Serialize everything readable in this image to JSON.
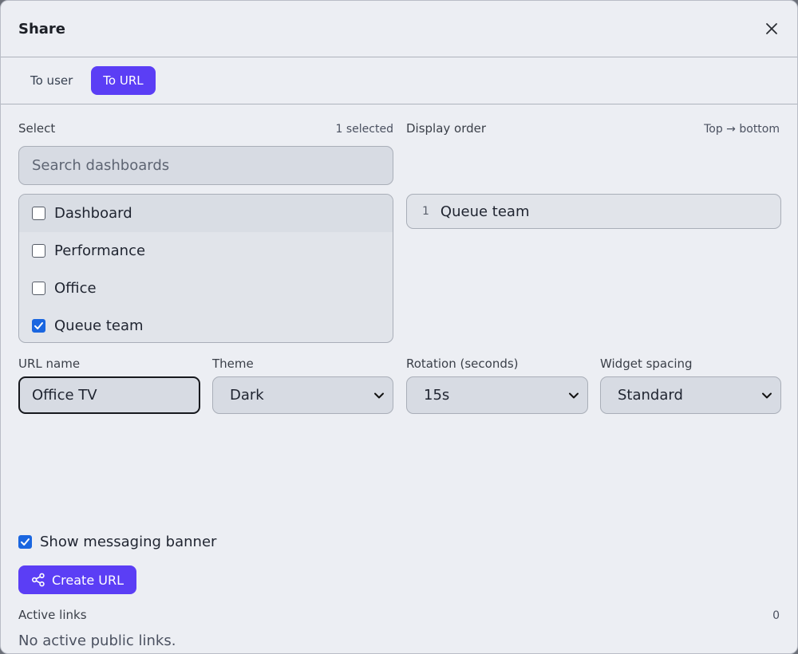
{
  "dialog": {
    "title": "Share"
  },
  "tabs": [
    {
      "label": "To user",
      "active": false
    },
    {
      "label": "To URL",
      "active": true
    }
  ],
  "select": {
    "label": "Select",
    "count": "1 selected",
    "search_placeholder": "Search dashboards",
    "items": [
      {
        "label": "Dashboard",
        "checked": false
      },
      {
        "label": "Performance",
        "checked": false
      },
      {
        "label": "Office",
        "checked": false
      },
      {
        "label": "Queue team",
        "checked": true
      }
    ]
  },
  "order": {
    "label": "Display order",
    "hint": "Top → bottom",
    "items": [
      {
        "num": "1",
        "label": "Queue team"
      }
    ]
  },
  "fields": {
    "url_name_label": "URL name",
    "url_name_value": "Office TV",
    "theme_label": "Theme",
    "theme_value": "Dark",
    "rotation_label": "Rotation (seconds)",
    "rotation_value": "15s",
    "spacing_label": "Widget spacing",
    "spacing_value": "Standard"
  },
  "banner": {
    "label": "Show messaging banner",
    "checked": true
  },
  "create_button": {
    "label": "Create URL"
  },
  "active_links": {
    "label": "Active links",
    "count": "0",
    "empty_text": "No active public links."
  },
  "colors": {
    "accent": "#5b3ef5",
    "checkbox": "#1a66e0"
  }
}
